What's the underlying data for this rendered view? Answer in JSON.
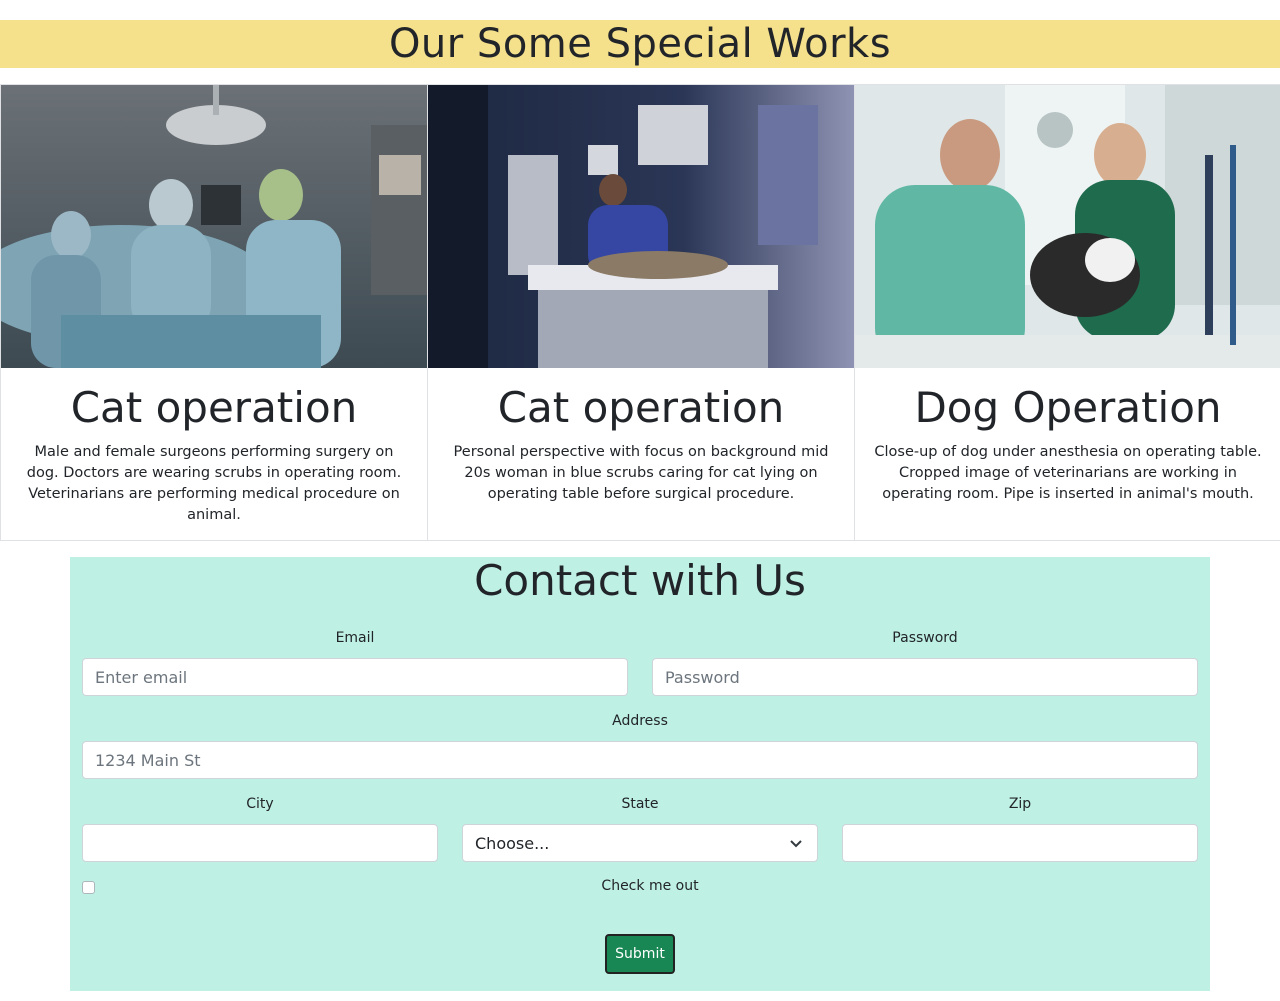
{
  "works": {
    "heading": "Our Some Special Works",
    "cards": [
      {
        "title": "Cat operation",
        "text": "Male and female surgeons performing surgery on dog. Doctors are wearing scrubs in operating room. Veterinarians are performing medical procedure on animal."
      },
      {
        "title": "Cat operation",
        "text": "Personal perspective with focus on background mid 20s woman in blue scrubs caring for cat lying on operating table before surgical procedure."
      },
      {
        "title": "Dog Operation",
        "text": "Close-up of dog under anesthesia on operating table. Cropped image of veterinarians are working in operating room. Pipe is inserted in animal's mouth."
      }
    ]
  },
  "contact": {
    "heading": "Contact with Us",
    "email_label": "Email",
    "email_placeholder": "Enter email",
    "password_label": "Password",
    "password_placeholder": "Password",
    "address_label": "Address",
    "address_placeholder": "1234 Main St",
    "city_label": "City",
    "state_label": "State",
    "state_selected": "Choose...",
    "zip_label": "Zip",
    "checkbox_label": "Check me out",
    "submit_label": "Submit"
  },
  "colors": {
    "banner": "#f5e08c",
    "contact_bg": "#bff0e4",
    "submit": "#198754"
  }
}
